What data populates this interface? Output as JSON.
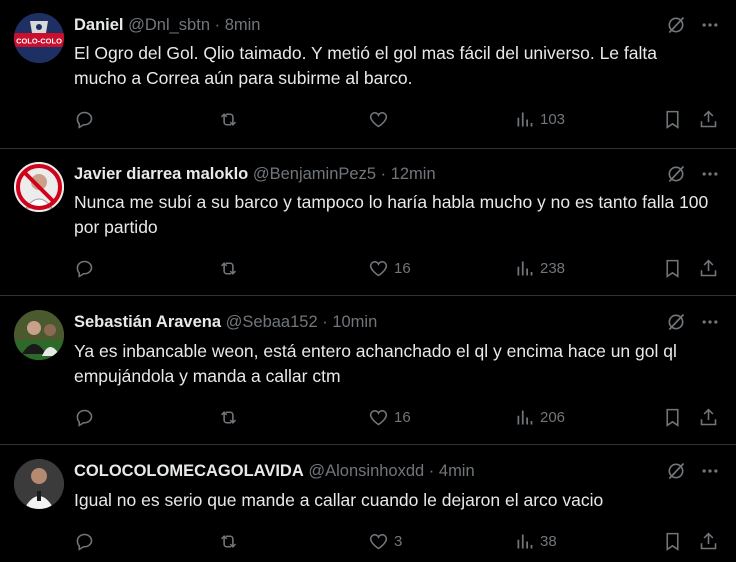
{
  "colors": {
    "background": "#000000",
    "text": "#e7e9ea",
    "muted": "#71767b",
    "divider": "#2f3336"
  },
  "tweets": [
    {
      "name": "Daniel",
      "handle": "@Dnl_sbtn",
      "sep": "·",
      "time": "8min",
      "text": "El Ogro del Gol. Qlio taimado. Y metió el gol mas fácil del universo. Le falta mucho a Correa aún para subirme al barco.",
      "avatar_label": "COLO-COLO",
      "likes": "",
      "views": "103"
    },
    {
      "name": "Javier diarrea maloklo",
      "handle": "@BenjaminPez5",
      "sep": "·",
      "time": "12min",
      "text": "Nunca me subí a su barco y tampoco lo haría habla mucho y no es tanto falla 100 por partido",
      "likes": "16",
      "views": "238"
    },
    {
      "name": "Sebastián Aravena",
      "handle": "@Sebaa152",
      "sep": "·",
      "time": "10min",
      "text": "Ya es inbancable weon, está entero achanchado el ql y encima hace un gol ql empujándola y manda a callar ctm",
      "likes": "16",
      "views": "206"
    },
    {
      "name": "COLOCOLOMECAGOLAVIDA",
      "handle": "@Alonsinhoxdd",
      "sep": "·",
      "time": "4min",
      "text": "Igual no es serio que mande a callar cuando le dejaron el arco vacio",
      "likes": "3",
      "views": "38"
    }
  ]
}
